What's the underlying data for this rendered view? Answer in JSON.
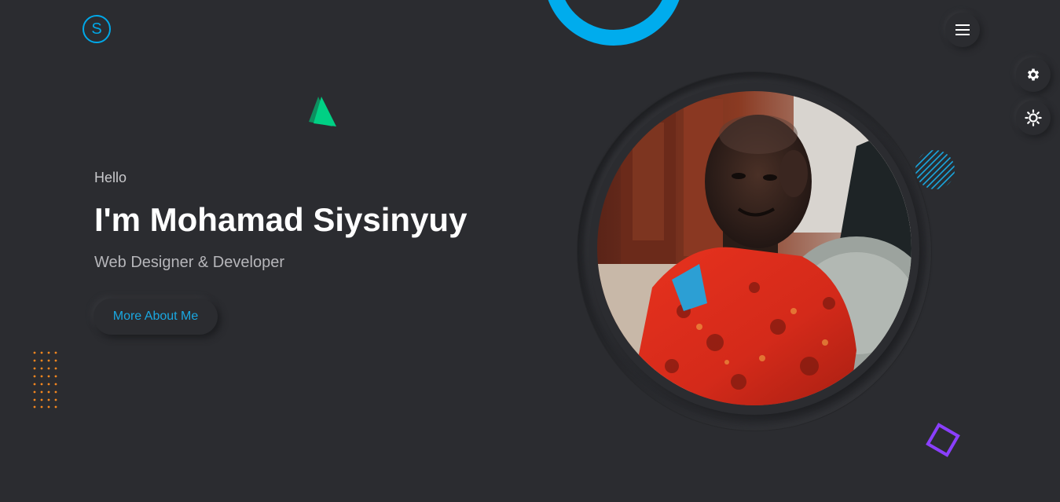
{
  "header": {
    "logo_letter": "S",
    "menu_icon": "hamburger-menu-icon"
  },
  "side_controls": {
    "settings_icon": "gear-icon",
    "theme_icon": "sun-icon"
  },
  "hero": {
    "greeting": "Hello",
    "name": "I'm Mohamad Siysinyuy",
    "role": "Web Designer & Developer",
    "cta_label": "More About Me"
  },
  "colors": {
    "background": "#2b2c30",
    "accent": "#00a8e8",
    "green_shape": "#00d084",
    "purple_shape": "#8a3ffc",
    "orange_dots": "#f5871f"
  }
}
